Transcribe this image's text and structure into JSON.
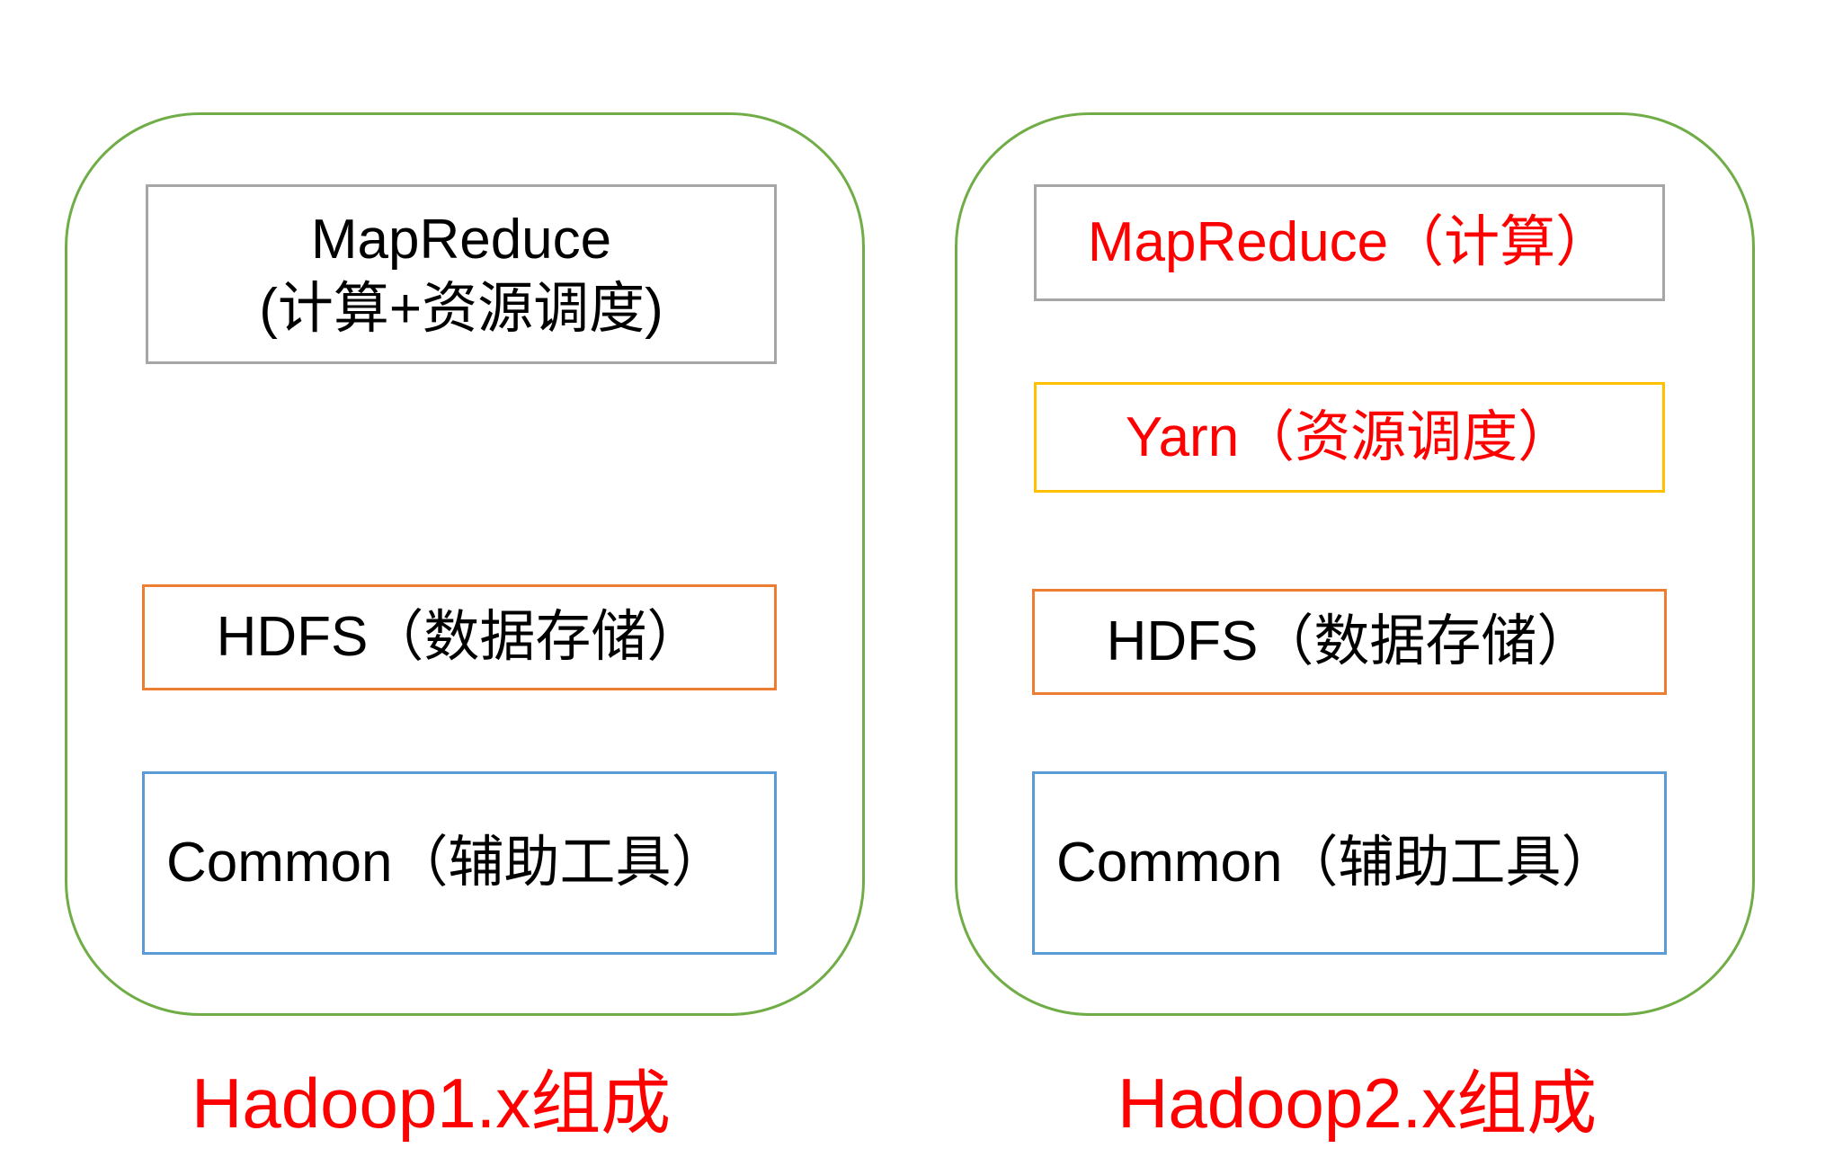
{
  "colors": {
    "panel_border": "#70ad47",
    "gray_border": "#a6a6a6",
    "orange_border": "#ed7d31",
    "blue_border": "#5b9bd5",
    "yellow_border": "#ffc000",
    "red_text": "#ff0000",
    "black_text": "#000000"
  },
  "hadoop1": {
    "caption": "Hadoop1.x组成",
    "mapreduce_line1": "MapReduce",
    "mapreduce_line2": "(计算+资源调度)",
    "hdfs": "HDFS（数据存储）",
    "common": "Common（辅助工具）"
  },
  "hadoop2": {
    "caption": "Hadoop2.x组成",
    "mapreduce": "MapReduce（计算）",
    "yarn": "Yarn（资源调度）",
    "hdfs": "HDFS（数据存储）",
    "common": "Common（辅助工具）"
  }
}
